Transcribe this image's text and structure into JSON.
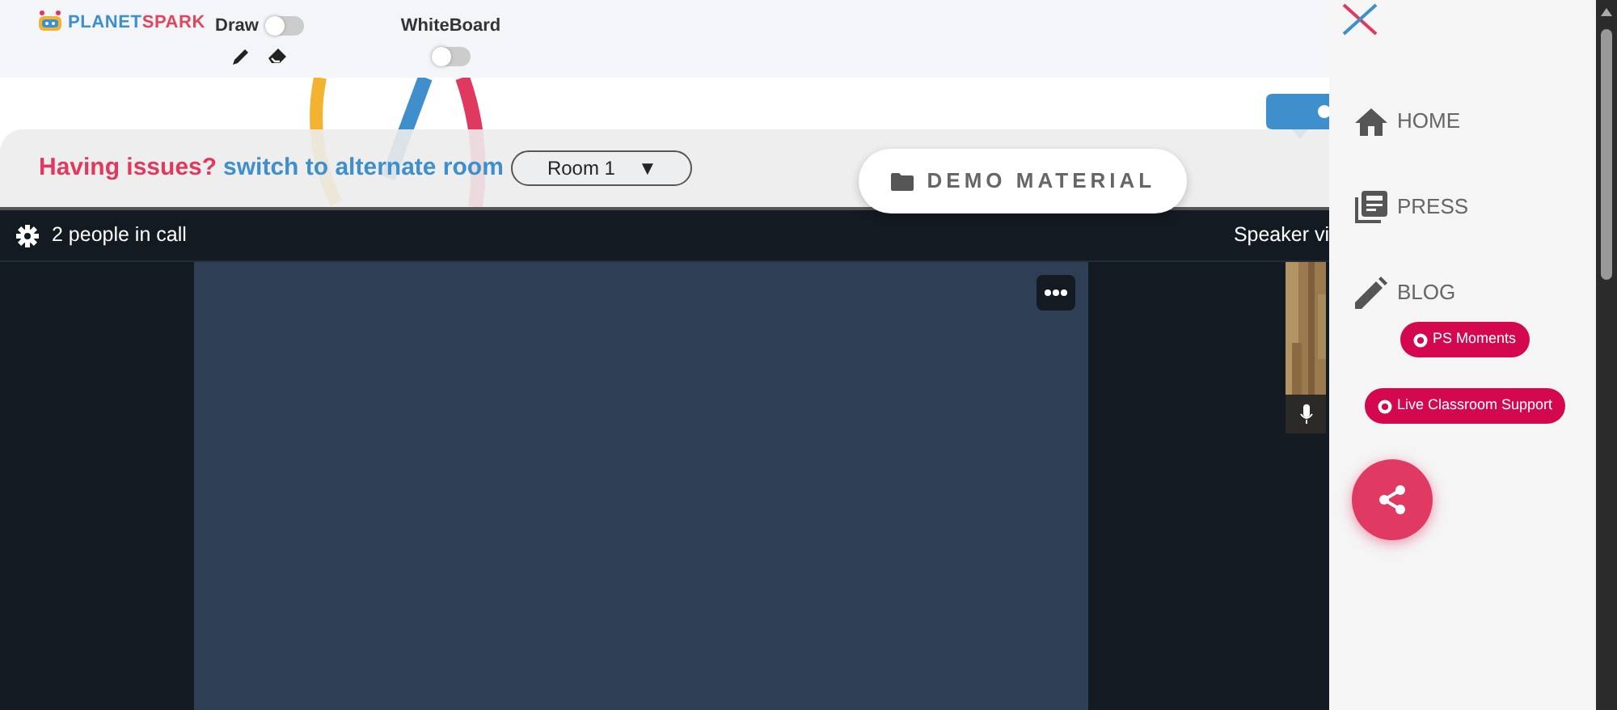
{
  "header": {
    "logo": {
      "part1": "PLANET",
      "part2": "SPARK"
    },
    "toggles": [
      {
        "label": "Draw",
        "on": false
      },
      {
        "label": "WhiteBoard",
        "on": false
      }
    ]
  },
  "issues_bar": {
    "prompt": "Having issues?",
    "link": "switch to alternate room",
    "room_select": {
      "value": "Room 1",
      "caret": "▼"
    },
    "demo_button": "DEMO MATERIAL"
  },
  "call": {
    "people": "2 people in call",
    "view": "Speaker vi"
  },
  "sidebar": {
    "items": [
      {
        "label": "HOME",
        "kind": "home"
      },
      {
        "label": "PRESS",
        "kind": "press"
      },
      {
        "label": "BLOG",
        "kind": "blog"
      }
    ],
    "pills": [
      "PS Moments",
      "Live Classroom Support"
    ]
  }
}
